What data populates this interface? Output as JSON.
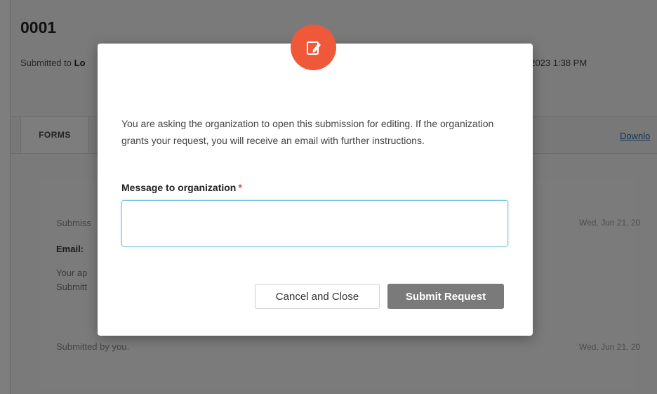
{
  "page": {
    "title": "0001",
    "submitted_to_prefix": "Submitted to",
    "submitted_to_org": "Lo",
    "date_right": ", 2023 1:38 PM",
    "tabs": {
      "forms": "FORMS"
    },
    "download_link": "Downlo",
    "timeline": [
      {
        "label": "Submiss",
        "email_label": "Email:",
        "line1": "Your ap",
        "line2": "Submitt",
        "date": "Wed, Jun 21, 20"
      },
      {
        "label": "Submitted by you.",
        "date": "Wed, Jun 21, 20"
      }
    ]
  },
  "modal": {
    "icon": "edit-note-icon",
    "message": "You are asking the organization to open this submission for editing. If the organization grants your request, you will receive an email with further instructions.",
    "field_label": "Message to organization",
    "required_marker": "*",
    "input_value": "",
    "cancel_label": "Cancel and Close",
    "submit_label": "Submit Request"
  },
  "colors": {
    "accent_icon": "#f0583a",
    "submit_button": "#7a7a7a",
    "input_focus_border": "#7cc4de",
    "link": "#2a6cb0"
  }
}
